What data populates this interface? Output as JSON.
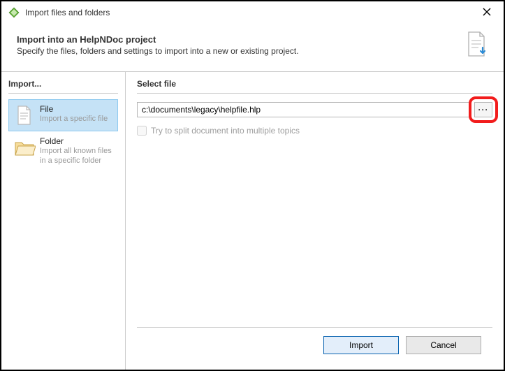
{
  "titlebar": {
    "title": "Import files and folders"
  },
  "header": {
    "title": "Import into an HelpNDoc project",
    "subtitle": "Specify the files, folders and settings to import into a new or existing project."
  },
  "sidebar": {
    "header": "Import...",
    "items": [
      {
        "label": "File",
        "sub": "Import a specific file"
      },
      {
        "label": "Folder",
        "sub": "Import all known files in a specific folder"
      }
    ]
  },
  "main": {
    "header": "Select file",
    "path": "c:\\documents\\legacy\\helpfile.hlp",
    "browse_label": "···",
    "split_label": "Try to split document into multiple topics"
  },
  "footer": {
    "import_label": "Import",
    "cancel_label": "Cancel"
  }
}
